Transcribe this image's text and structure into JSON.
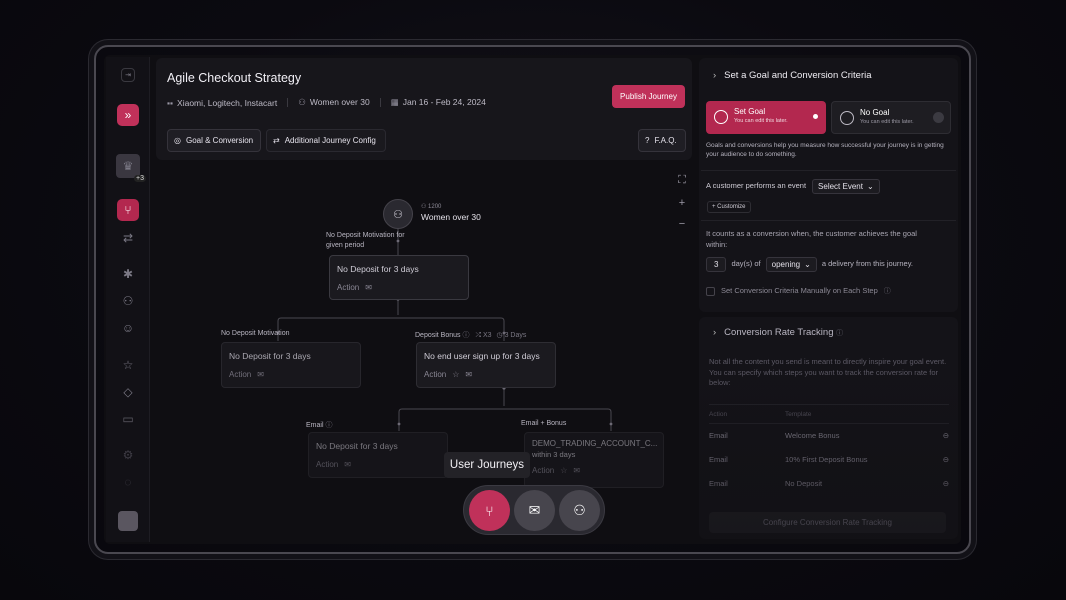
{
  "header": {
    "title": "Agile Checkout Strategy",
    "brands": "Xiaomi, Logitech, Instacart",
    "audience": "Women over 30",
    "dates": "Jan 16 - Feb 24, 2024",
    "publish_label": "Publish Journey",
    "tab_goal": "Goal & Conversion",
    "tab_config": "Additional Journey Config",
    "faq": "F.A.Q."
  },
  "rail": {
    "badge": "+3"
  },
  "canvas": {
    "root": {
      "count": "1200",
      "label": "Women over 30"
    },
    "branch_label": "No Deposit Motivation for given period",
    "n1": {
      "title": "No Deposit for 3 days",
      "action": "Action"
    },
    "left_label": "No Deposit Motivation",
    "right_label": "Deposit Bonus",
    "right_meta1": "X3",
    "right_meta2": "3 Days",
    "n2": {
      "title": "No Deposit for 3 days",
      "action": "Action"
    },
    "n3": {
      "title": "No end user sign up for 3 days",
      "action": "Action"
    },
    "email_label": "Email",
    "email_bonus_label": "Email + Bonus",
    "n4": {
      "title": "No Deposit for 3 days",
      "action": "Action"
    },
    "n5": {
      "title": "DEMO_TRADING_ACCOUNT_C...",
      "sub": "within 3 days",
      "action": "Action"
    }
  },
  "tooltip": "User Journeys",
  "panel": {
    "title": "Set a Goal and Conversion Criteria",
    "set_goal": "Set Goal",
    "set_goal_sub": "You can edit this later.",
    "no_goal": "No Goal",
    "no_goal_sub": "You can edit this later.",
    "desc": "Goals and conversions help you measure how successful your journey is in getting your audience to do something.",
    "performs": "A customer performs an event",
    "select_event": "Select Event",
    "customize": "+ Customize",
    "counts": "It counts as a conversion when, the customer achieves the goal within:",
    "days_value": "3",
    "days_of": "day(s) of",
    "opening": "opening",
    "delivery": "a delivery from this journey.",
    "manual": "Set Conversion Criteria Manually on Each Step"
  },
  "tracking": {
    "title": "Conversion Rate Tracking",
    "desc": "Not all the content you send is meant to directly inspire your goal event. You can specify which steps you want to track the conversion rate for below:",
    "col_action": "Action",
    "col_template": "Template",
    "rows": [
      {
        "action": "Email",
        "template": "Welcome Bonus"
      },
      {
        "action": "Email",
        "template": "10% First Deposit Bonus"
      },
      {
        "action": "Email",
        "template": "No Deposit"
      }
    ],
    "configure": "Configure Conversion Rate Tracking"
  },
  "colors": {
    "accent": "#c0315a",
    "bg": "#0f0e12",
    "card": "#17161b"
  }
}
